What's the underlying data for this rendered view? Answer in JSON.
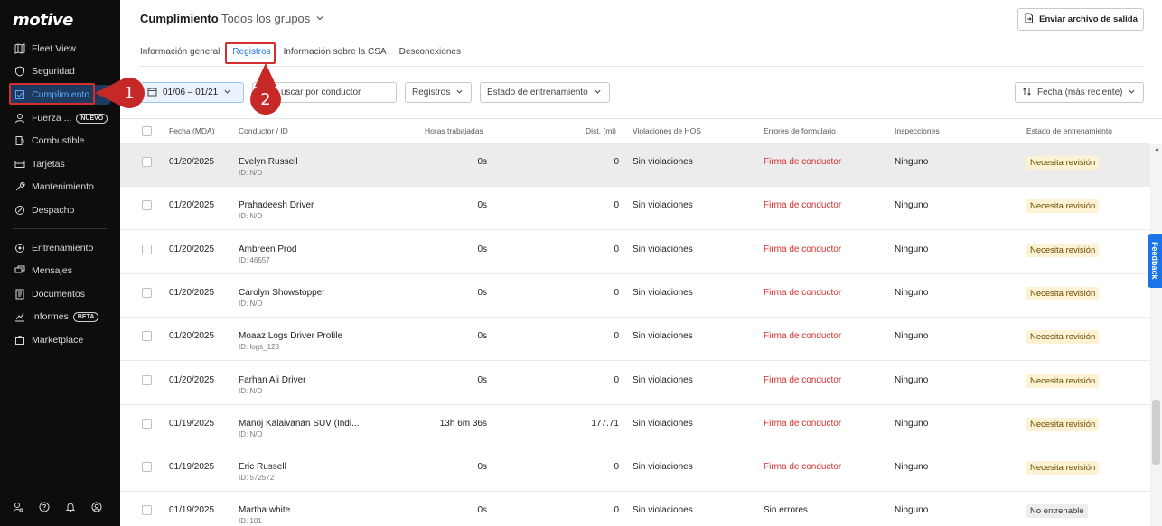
{
  "app": {
    "logo": "motive"
  },
  "sidebar": {
    "items": [
      {
        "label": "Fleet View",
        "icon": "map-icon"
      },
      {
        "label": "Seguridad",
        "icon": "shield-icon"
      },
      {
        "label": "Cumplimiento",
        "icon": "compliance-icon",
        "active": true
      },
      {
        "label": "Fuerza ...",
        "icon": "workforce-icon",
        "badge": "NUEVO"
      },
      {
        "label": "Combustible",
        "icon": "fuel-icon"
      },
      {
        "label": "Tarjetas",
        "icon": "card-icon"
      },
      {
        "label": "Mantenimiento",
        "icon": "wrench-icon"
      },
      {
        "label": "Despacho",
        "icon": "dispatch-icon"
      },
      {
        "label": "Entrenamiento",
        "icon": "training-icon"
      },
      {
        "label": "Mensajes",
        "icon": "messages-icon"
      },
      {
        "label": "Documentos",
        "icon": "documents-icon"
      },
      {
        "label": "Informes",
        "icon": "reports-icon",
        "badge": "BETA"
      },
      {
        "label": "Marketplace",
        "icon": "marketplace-icon"
      }
    ]
  },
  "header": {
    "title": "Cumplimiento",
    "group": "Todos los grupos",
    "export_label": "Enviar archivo de salida"
  },
  "tabs": [
    {
      "label": "Información general"
    },
    {
      "label": "Registros",
      "active": true
    },
    {
      "label": "Información sobre la CSA"
    },
    {
      "label": "Desconexiones"
    }
  ],
  "filters": {
    "date": "01/06 – 01/21",
    "search_placeholder": "Buscar por conductor",
    "search_visible": "uscar por conductor",
    "logs": "Registros",
    "training_status": "Estado de entrenamiento",
    "sort": "Fecha (más reciente)"
  },
  "table": {
    "columns": [
      "Fecha (MDA)",
      "Conductor / ID",
      "Horas trabajadas",
      "Dist. (mi)",
      "Violaciones de HOS",
      "Errores de formulario",
      "Inspecciones",
      "Estado de entrenamiento"
    ],
    "rows": [
      {
        "date": "01/20/2025",
        "driver": "Evelyn Russell",
        "id": "ID: N/D",
        "hours": "0s",
        "dist": "0",
        "hos": "Sin violaciones",
        "form": "Firma de conductor",
        "form_error": true,
        "insp": "Ninguno",
        "status": "Necesita revisión",
        "status_type": "warn"
      },
      {
        "date": "01/20/2025",
        "driver": "Prahadeesh Driver",
        "id": "ID: N/D",
        "hours": "0s",
        "dist": "0",
        "hos": "Sin violaciones",
        "form": "Firma de conductor",
        "form_error": true,
        "insp": "Ninguno",
        "status": "Necesita revisión",
        "status_type": "warn"
      },
      {
        "date": "01/20/2025",
        "driver": "Ambreen Prod",
        "id": "ID: 46557",
        "hours": "0s",
        "dist": "0",
        "hos": "Sin violaciones",
        "form": "Firma de conductor",
        "form_error": true,
        "insp": "Ninguno",
        "status": "Necesita revisión",
        "status_type": "warn"
      },
      {
        "date": "01/20/2025",
        "driver": "Carolyn Showstopper",
        "id": "ID: N/D",
        "hours": "0s",
        "dist": "0",
        "hos": "Sin violaciones",
        "form": "Firma de conductor",
        "form_error": true,
        "insp": "Ninguno",
        "status": "Necesita revisión",
        "status_type": "warn"
      },
      {
        "date": "01/20/2025",
        "driver": "Moaaz Logs Driver Profile",
        "id": "ID: logs_123",
        "hours": "0s",
        "dist": "0",
        "hos": "Sin violaciones",
        "form": "Firma de conductor",
        "form_error": true,
        "insp": "Ninguno",
        "status": "Necesita revisión",
        "status_type": "warn"
      },
      {
        "date": "01/20/2025",
        "driver": "Farhan Ali Driver",
        "id": "ID: N/D",
        "hours": "0s",
        "dist": "0",
        "hos": "Sin violaciones",
        "form": "Firma de conductor",
        "form_error": true,
        "insp": "Ninguno",
        "status": "Necesita revisión",
        "status_type": "warn"
      },
      {
        "date": "01/19/2025",
        "driver": "Manoj Kalaivanan SUV (Indi...",
        "id": "ID: N/D",
        "hours": "13h 6m 36s",
        "dist": "177.71",
        "hos": "Sin violaciones",
        "form": "Firma de conductor",
        "form_error": true,
        "insp": "Ninguno",
        "status": "Necesita revisión",
        "status_type": "warn"
      },
      {
        "date": "01/19/2025",
        "driver": "Eric Russell",
        "id": "ID: 572572",
        "hours": "0s",
        "dist": "0",
        "hos": "Sin violaciones",
        "form": "Firma de conductor",
        "form_error": true,
        "insp": "Ninguno",
        "status": "Necesita revisión",
        "status_type": "warn"
      },
      {
        "date": "01/19/2025",
        "driver": "Martha white",
        "id": "ID: 101",
        "hours": "0s",
        "dist": "0",
        "hos": "Sin violaciones",
        "form": "Sin errores",
        "form_error": false,
        "insp": "Ninguno",
        "status": "No entrenable",
        "status_type": "grey"
      }
    ]
  },
  "feedback_label": "Feedback",
  "annotations": [
    "1",
    "2"
  ]
}
